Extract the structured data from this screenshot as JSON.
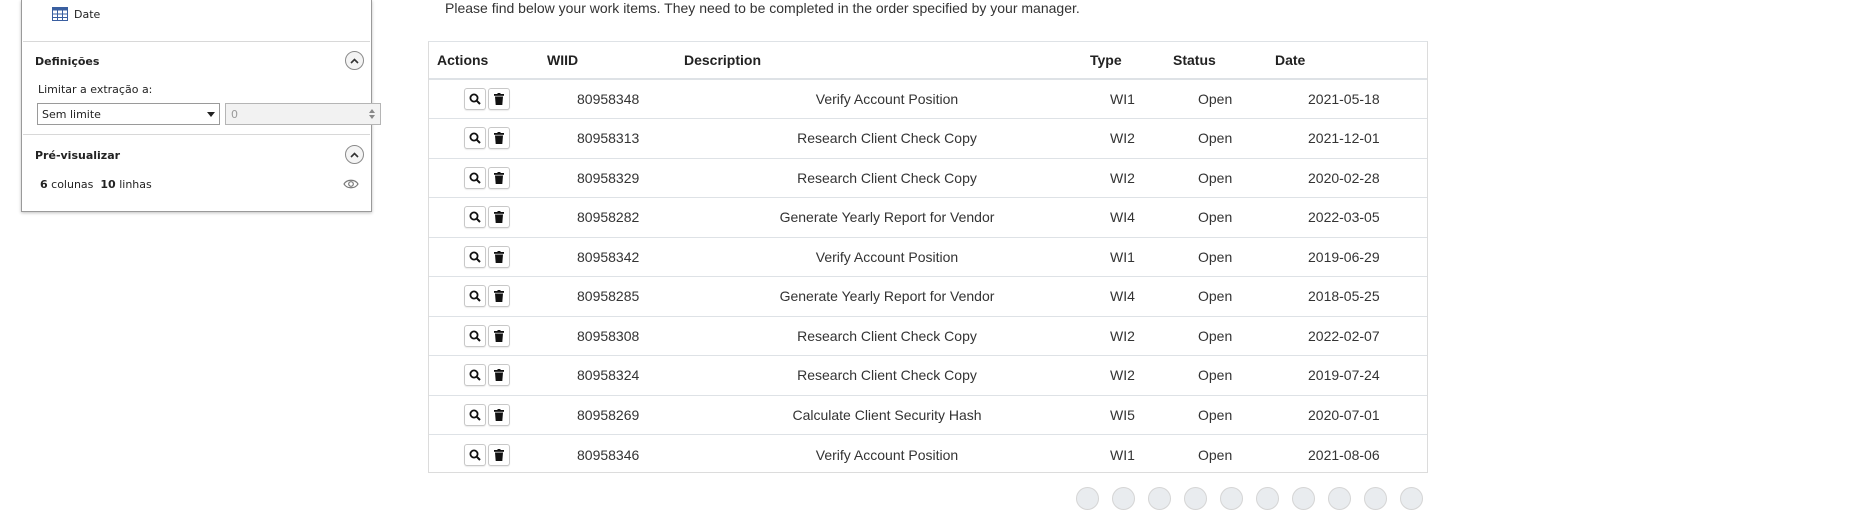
{
  "panel": {
    "date_field_label": "Date",
    "settings_title": "Definições",
    "limit_label": "Limitar a extração a:",
    "limit_select_value": "Sem limite",
    "limit_number_value": "0",
    "preview_title": "Pré-visualizar",
    "preview_columns_count": "6",
    "preview_columns_word": "colunas",
    "preview_rows_count": "10",
    "preview_rows_word": "linhas"
  },
  "intro_text": "Please find below your work items. They need to be completed in the order specified by your manager.",
  "table": {
    "headers": [
      "Actions",
      "WIID",
      "Description",
      "Type",
      "Status",
      "Date"
    ],
    "rows": [
      {
        "wiid": "80958348",
        "description": "Verify Account Position",
        "type": "WI1",
        "status": "Open",
        "date": "2021-05-18"
      },
      {
        "wiid": "80958313",
        "description": "Research Client Check Copy",
        "type": "WI2",
        "status": "Open",
        "date": "2021-12-01"
      },
      {
        "wiid": "80958329",
        "description": "Research Client Check Copy",
        "type": "WI2",
        "status": "Open",
        "date": "2020-02-28"
      },
      {
        "wiid": "80958282",
        "description": "Generate Yearly Report for Vendor",
        "type": "WI4",
        "status": "Open",
        "date": "2022-03-05"
      },
      {
        "wiid": "80958342",
        "description": "Verify Account Position",
        "type": "WI1",
        "status": "Open",
        "date": "2019-06-29"
      },
      {
        "wiid": "80958285",
        "description": "Generate Yearly Report for Vendor",
        "type": "WI4",
        "status": "Open",
        "date": "2018-05-25"
      },
      {
        "wiid": "80958308",
        "description": "Research Client Check Copy",
        "type": "WI2",
        "status": "Open",
        "date": "2022-02-07"
      },
      {
        "wiid": "80958324",
        "description": "Research Client Check Copy",
        "type": "WI2",
        "status": "Open",
        "date": "2019-07-24"
      },
      {
        "wiid": "80958269",
        "description": "Calculate Client Security Hash",
        "type": "WI5",
        "status": "Open",
        "date": "2020-07-01"
      },
      {
        "wiid": "80958346",
        "description": "Verify Account Position",
        "type": "WI1",
        "status": "Open",
        "date": "2021-08-06"
      }
    ]
  },
  "icons": {
    "view": "search-icon",
    "delete": "trash-icon",
    "date_field": "table-icon",
    "collapse": "chevron-up-icon",
    "preview": "eye-icon"
  },
  "colors": {
    "panel_border": "#9a9a9a",
    "table_border": "#dee2e6",
    "pager_bg": "#e9ecef"
  }
}
